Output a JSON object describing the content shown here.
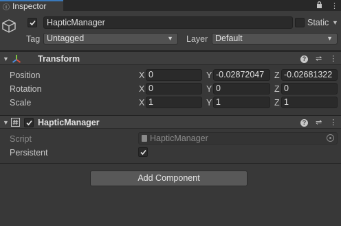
{
  "window": {
    "tab_label": "Inspector",
    "tab_icon": "info-icon",
    "lock_icon": "lock-icon",
    "menu_icon": "kebab-menu-icon"
  },
  "header": {
    "object_name": "HapticManager",
    "active": true,
    "static_label": "Static",
    "static_checked": false,
    "tag_label": "Tag",
    "tag_value": "Untagged",
    "layer_label": "Layer",
    "layer_value": "Default"
  },
  "transform": {
    "title": "Transform",
    "rows": [
      {
        "label": "Position",
        "x": "0",
        "y": "-0.02872047",
        "z": "-0.02681322"
      },
      {
        "label": "Rotation",
        "x": "0",
        "y": "0",
        "z": "0"
      },
      {
        "label": "Scale",
        "x": "1",
        "y": "1",
        "z": "1"
      }
    ]
  },
  "axes": {
    "x": "X",
    "y": "Y",
    "z": "Z"
  },
  "haptic_component": {
    "title": "HapticManager",
    "enabled": true,
    "script_label": "Script",
    "script_value": "HapticManager",
    "persistent_label": "Persistent",
    "persistent_checked": true
  },
  "add_component_label": "Add Component",
  "colors": {
    "panel_bg": "#383838",
    "header_bg": "#3e3e3e",
    "field_bg": "#2a2a2a",
    "tab_accent": "#3a79bb"
  }
}
